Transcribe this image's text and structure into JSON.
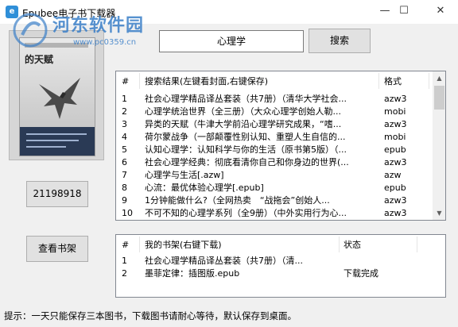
{
  "window": {
    "title": "Epubee电子书下载器",
    "app_icon_glyph": "e",
    "minimize_glyph": "—",
    "maximize_glyph": "☐",
    "close_glyph": "✕"
  },
  "watermark": {
    "name": "河东软件园",
    "url": "www.pc0359.cn"
  },
  "cover": {
    "title_text": "的天赋"
  },
  "search": {
    "value": "心理学",
    "button_label": "搜索"
  },
  "book_id_button": "21198918",
  "shelf_button": "查看书架",
  "results": {
    "headers": {
      "num": "#",
      "title": "搜索结果(左键看封面,右键保存)",
      "format": "格式"
    },
    "rows": [
      {
        "num": "1",
        "title": "社会心理学精品译丛套装（共7册）（清华大学社会...",
        "format": "azw3"
      },
      {
        "num": "2",
        "title": "心理学统治世界（全三册）（大众心理学创始人勒...",
        "format": "mobi"
      },
      {
        "num": "3",
        "title": "异类的天赋（牛津大学前沿心理学研究成果，“嗜...",
        "format": "azw3"
      },
      {
        "num": "4",
        "title": "荷尔蒙战争（一部颠覆性别认知、重塑人生自信的...",
        "format": "mobi"
      },
      {
        "num": "5",
        "title": "认知心理学：认知科学与你的生活（原书第5版）（...",
        "format": "epub"
      },
      {
        "num": "6",
        "title": "社会心理学经典：彻底看清你自己和你身边的世界(...",
        "format": "azw3"
      },
      {
        "num": "7",
        "title": "心理学与生活[.azw]",
        "format": "azw"
      },
      {
        "num": "8",
        "title": "心流：最优体验心理学[.epub]",
        "format": "epub"
      },
      {
        "num": "9",
        "title": "1分钟能做什么?（全网热卖　“战拖会”创始人...",
        "format": "azw3"
      },
      {
        "num": "10",
        "title": "不可不知的心理学系列（全9册）（中外实用行为心...",
        "format": "azw3"
      }
    ]
  },
  "shelf": {
    "headers": {
      "num": "#",
      "title": "我的书架(右键下载)",
      "status": "状态"
    },
    "rows": [
      {
        "num": "1",
        "title": "社会心理学精品译丛套装（共7册）（清...",
        "status": ""
      },
      {
        "num": "2",
        "title": "墨菲定律：插图版.epub",
        "status": "下载完成"
      }
    ]
  },
  "status_text": "提示：一天只能保存三本图书，下载图书请耐心等待，默认保存到桌面。",
  "colors": {
    "watermark": "#3a7fc8",
    "window_bg": "#f0f0f0",
    "list_border": "#828790"
  }
}
